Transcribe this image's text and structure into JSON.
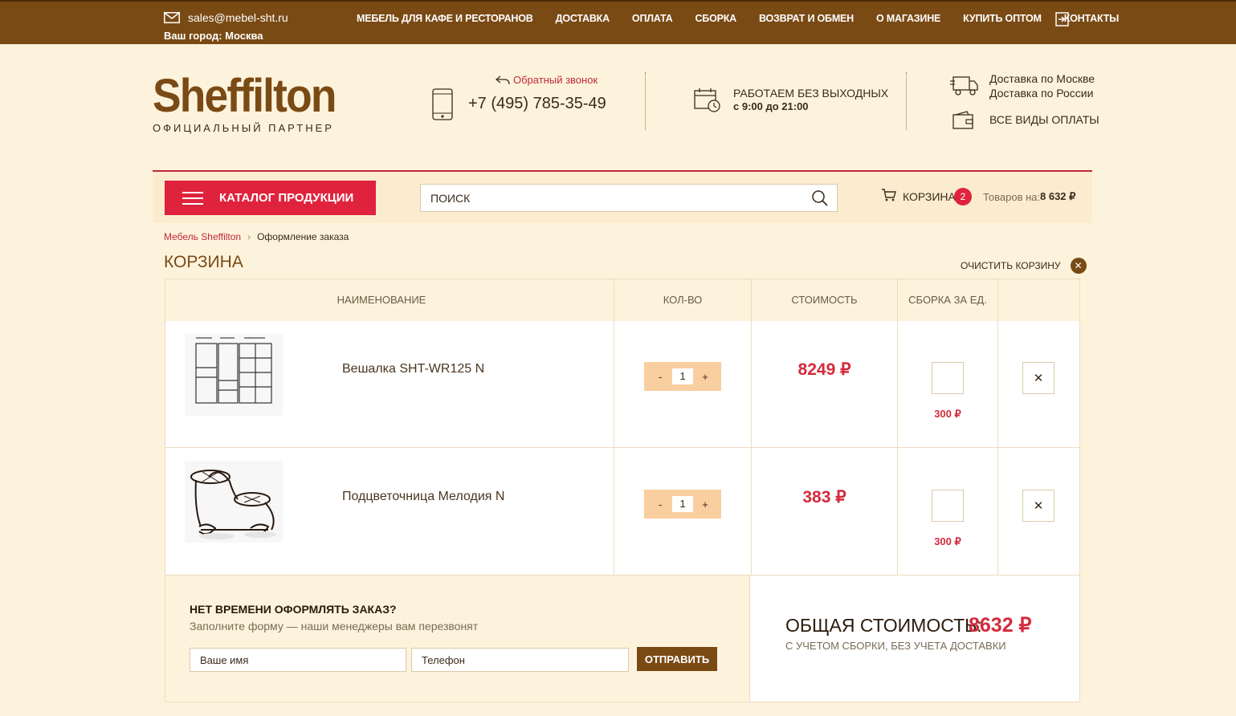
{
  "topbar": {
    "email": "sales@mebel-sht.ru",
    "city": "Ваш город: Москва",
    "nav": [
      "МЕБЕЛЬ ДЛЯ КАФЕ И РЕСТОРАНОВ",
      "ДОСТАВКА",
      "ОПЛАТА",
      "СБОРКА",
      "ВОЗВРАТ И ОБМЕН",
      "О МАГАЗИНЕ",
      "КУПИТЬ ОПТОМ",
      "КОНТАКТЫ"
    ]
  },
  "header": {
    "logo": "Sheffilton",
    "logo_sub": "ОФИЦИАЛЬНЫЙ ПАРТНЕР",
    "callback": "Обратный звонок",
    "phone": "+7 (495) 785-35-49",
    "work_line1": "РАБОТАЕМ БЕЗ ВЫХОДНЫХ",
    "work_line2": "с 9:00 до 21:00",
    "delivery_moscow": "Доставка по Москве",
    "delivery_russia": "Доставка по России",
    "payment": "ВСЕ ВИДЫ ОПЛАТЫ"
  },
  "catbar": {
    "catalog_label": "КАТАЛОГ ПРОДУКЦИИ",
    "search_placeholder": "ПОИСК",
    "cart_label": "КОРЗИНА",
    "cart_count": "2",
    "cart_total_label": "Товаров на:",
    "cart_total": "8 632 ₽"
  },
  "breadcrumb": {
    "home": "Мебель Sheffilton",
    "current": "Оформление заказа"
  },
  "cart": {
    "title": "КОРЗИНА",
    "clear_label": "ОЧИСТИТЬ КОРЗИНУ",
    "columns": [
      "НАИМЕНОВАНИЕ",
      "КОЛ-ВО",
      "СТОИМОСТЬ",
      "СБОРКА ЗА ЕД."
    ],
    "items": [
      {
        "name": "Вешалка SHT-WR125 N",
        "qty": "1",
        "price": "8249 ₽",
        "assembly": "300 ₽"
      },
      {
        "name": "Подцветочница Мелодия N",
        "qty": "1",
        "price": "383 ₽",
        "assembly": "300 ₽"
      }
    ]
  },
  "quick_order": {
    "title": "НЕТ ВРЕМЕНИ ОФОРМЛЯТЬ ЗАКАЗ?",
    "subtitle": "Заполните форму — наши менеджеры вам перезвонят",
    "name_placeholder": "Ваше имя",
    "phone_placeholder": "Телефон",
    "submit": "ОТПРАВИТЬ"
  },
  "total": {
    "label": "ОБЩАЯ СТОИМОСТЬ:",
    "value": "8632 ₽",
    "note": "С УЧЕТОМ СБОРКИ, БЕЗ УЧЕТА ДОСТАВКИ"
  },
  "colors": {
    "brand_brown": "#7a4a15",
    "accent_red": "#e0233c",
    "background": "#fdf3dc"
  }
}
